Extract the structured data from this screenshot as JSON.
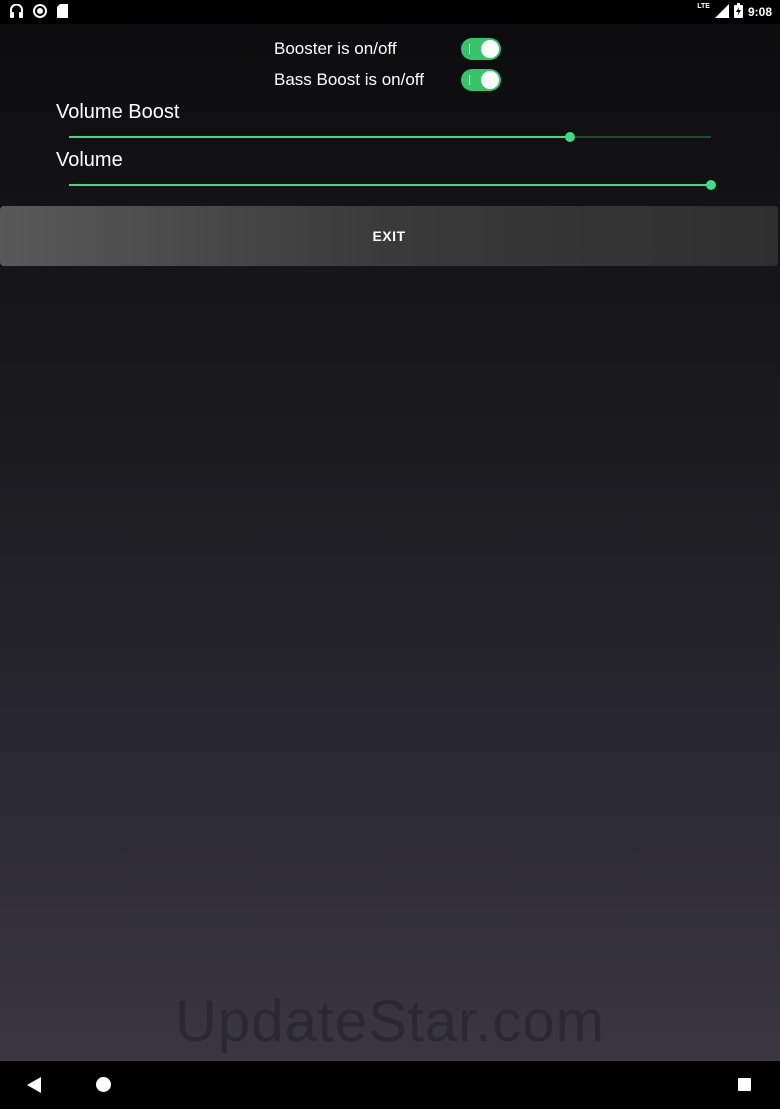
{
  "status_bar": {
    "time": "9:08",
    "network": "LTE",
    "left_icons": [
      "headset-icon",
      "record-icon",
      "sd-card-icon"
    ],
    "right_icons": [
      "signal-icon",
      "battery-icon"
    ]
  },
  "toggles": [
    {
      "label": "Booster is on/off",
      "on": true
    },
    {
      "label": "Bass Boost is on/off",
      "on": true
    }
  ],
  "sliders": [
    {
      "label": "Volume Boost",
      "value_fraction": 0.78
    },
    {
      "label": "Volume",
      "value_fraction": 1.0
    }
  ],
  "exit_button": {
    "label": "EXIT"
  },
  "watermark": "UpdateStar.com",
  "nav_bar": {
    "icons": [
      "back-icon",
      "home-icon",
      "recents-icon"
    ]
  },
  "colors": {
    "accent": "#3fdc86",
    "switch_on": "#35c46a"
  }
}
